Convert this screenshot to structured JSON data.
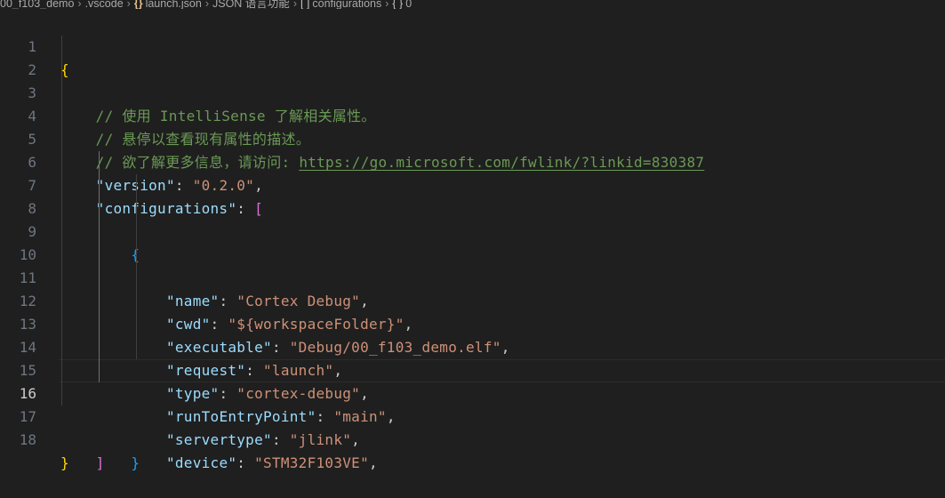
{
  "breadcrumb": {
    "folder": "00_f103_demo",
    "subfolder": ".vscode",
    "file_icon": "{}",
    "file": "launch.json",
    "schema": "JSON 语言功能",
    "array_icon": "[ ]",
    "array": "configurations",
    "object_icon": "{ }",
    "index": "0"
  },
  "editor": {
    "active_line": 16,
    "line_numbers": [
      "1",
      "2",
      "3",
      "4",
      "5",
      "6",
      "7",
      "8",
      "9",
      "10",
      "11",
      "12",
      "13",
      "14",
      "15",
      "16",
      "17",
      "18"
    ],
    "open_brace": "{",
    "comment_1": "// 使用 IntelliSense 了解相关属性。",
    "comment_2": "// 悬停以查看现有属性的描述。",
    "comment_3_prefix": "// 欲了解更多信息，请访问: ",
    "comment_3_link": "https://go.microsoft.com/fwlink/?linkid=830387",
    "version_key": "\"version\"",
    "version_value": "\"0.2.0\"",
    "configurations_key": "\"configurations\"",
    "open_bracket": "[",
    "inner_open_brace": "{",
    "props": [
      {
        "key": "\"name\"",
        "value": "\"Cortex Debug\""
      },
      {
        "key": "\"cwd\"",
        "value": "\"${workspaceFolder}\""
      },
      {
        "key": "\"executable\"",
        "value": "\"Debug/00_f103_demo.elf\""
      },
      {
        "key": "\"request\"",
        "value": "\"launch\""
      },
      {
        "key": "\"type\"",
        "value": "\"cortex-debug\""
      },
      {
        "key": "\"runToEntryPoint\"",
        "value": "\"main\""
      },
      {
        "key": "\"servertype\"",
        "value": "\"jlink\""
      },
      {
        "key": "\"device\"",
        "value": "\"STM32F103VE\""
      }
    ],
    "inner_close_brace": "}",
    "close_bracket": "]",
    "close_brace": "}"
  },
  "colors": {
    "background": "#1f1f1f",
    "key": "#9cdcfe",
    "string": "#ce9178",
    "comment": "#6a9955",
    "bracket_level1": "#ffd700",
    "bracket_level2": "#da70d6",
    "bracket_level3": "#179fff"
  }
}
